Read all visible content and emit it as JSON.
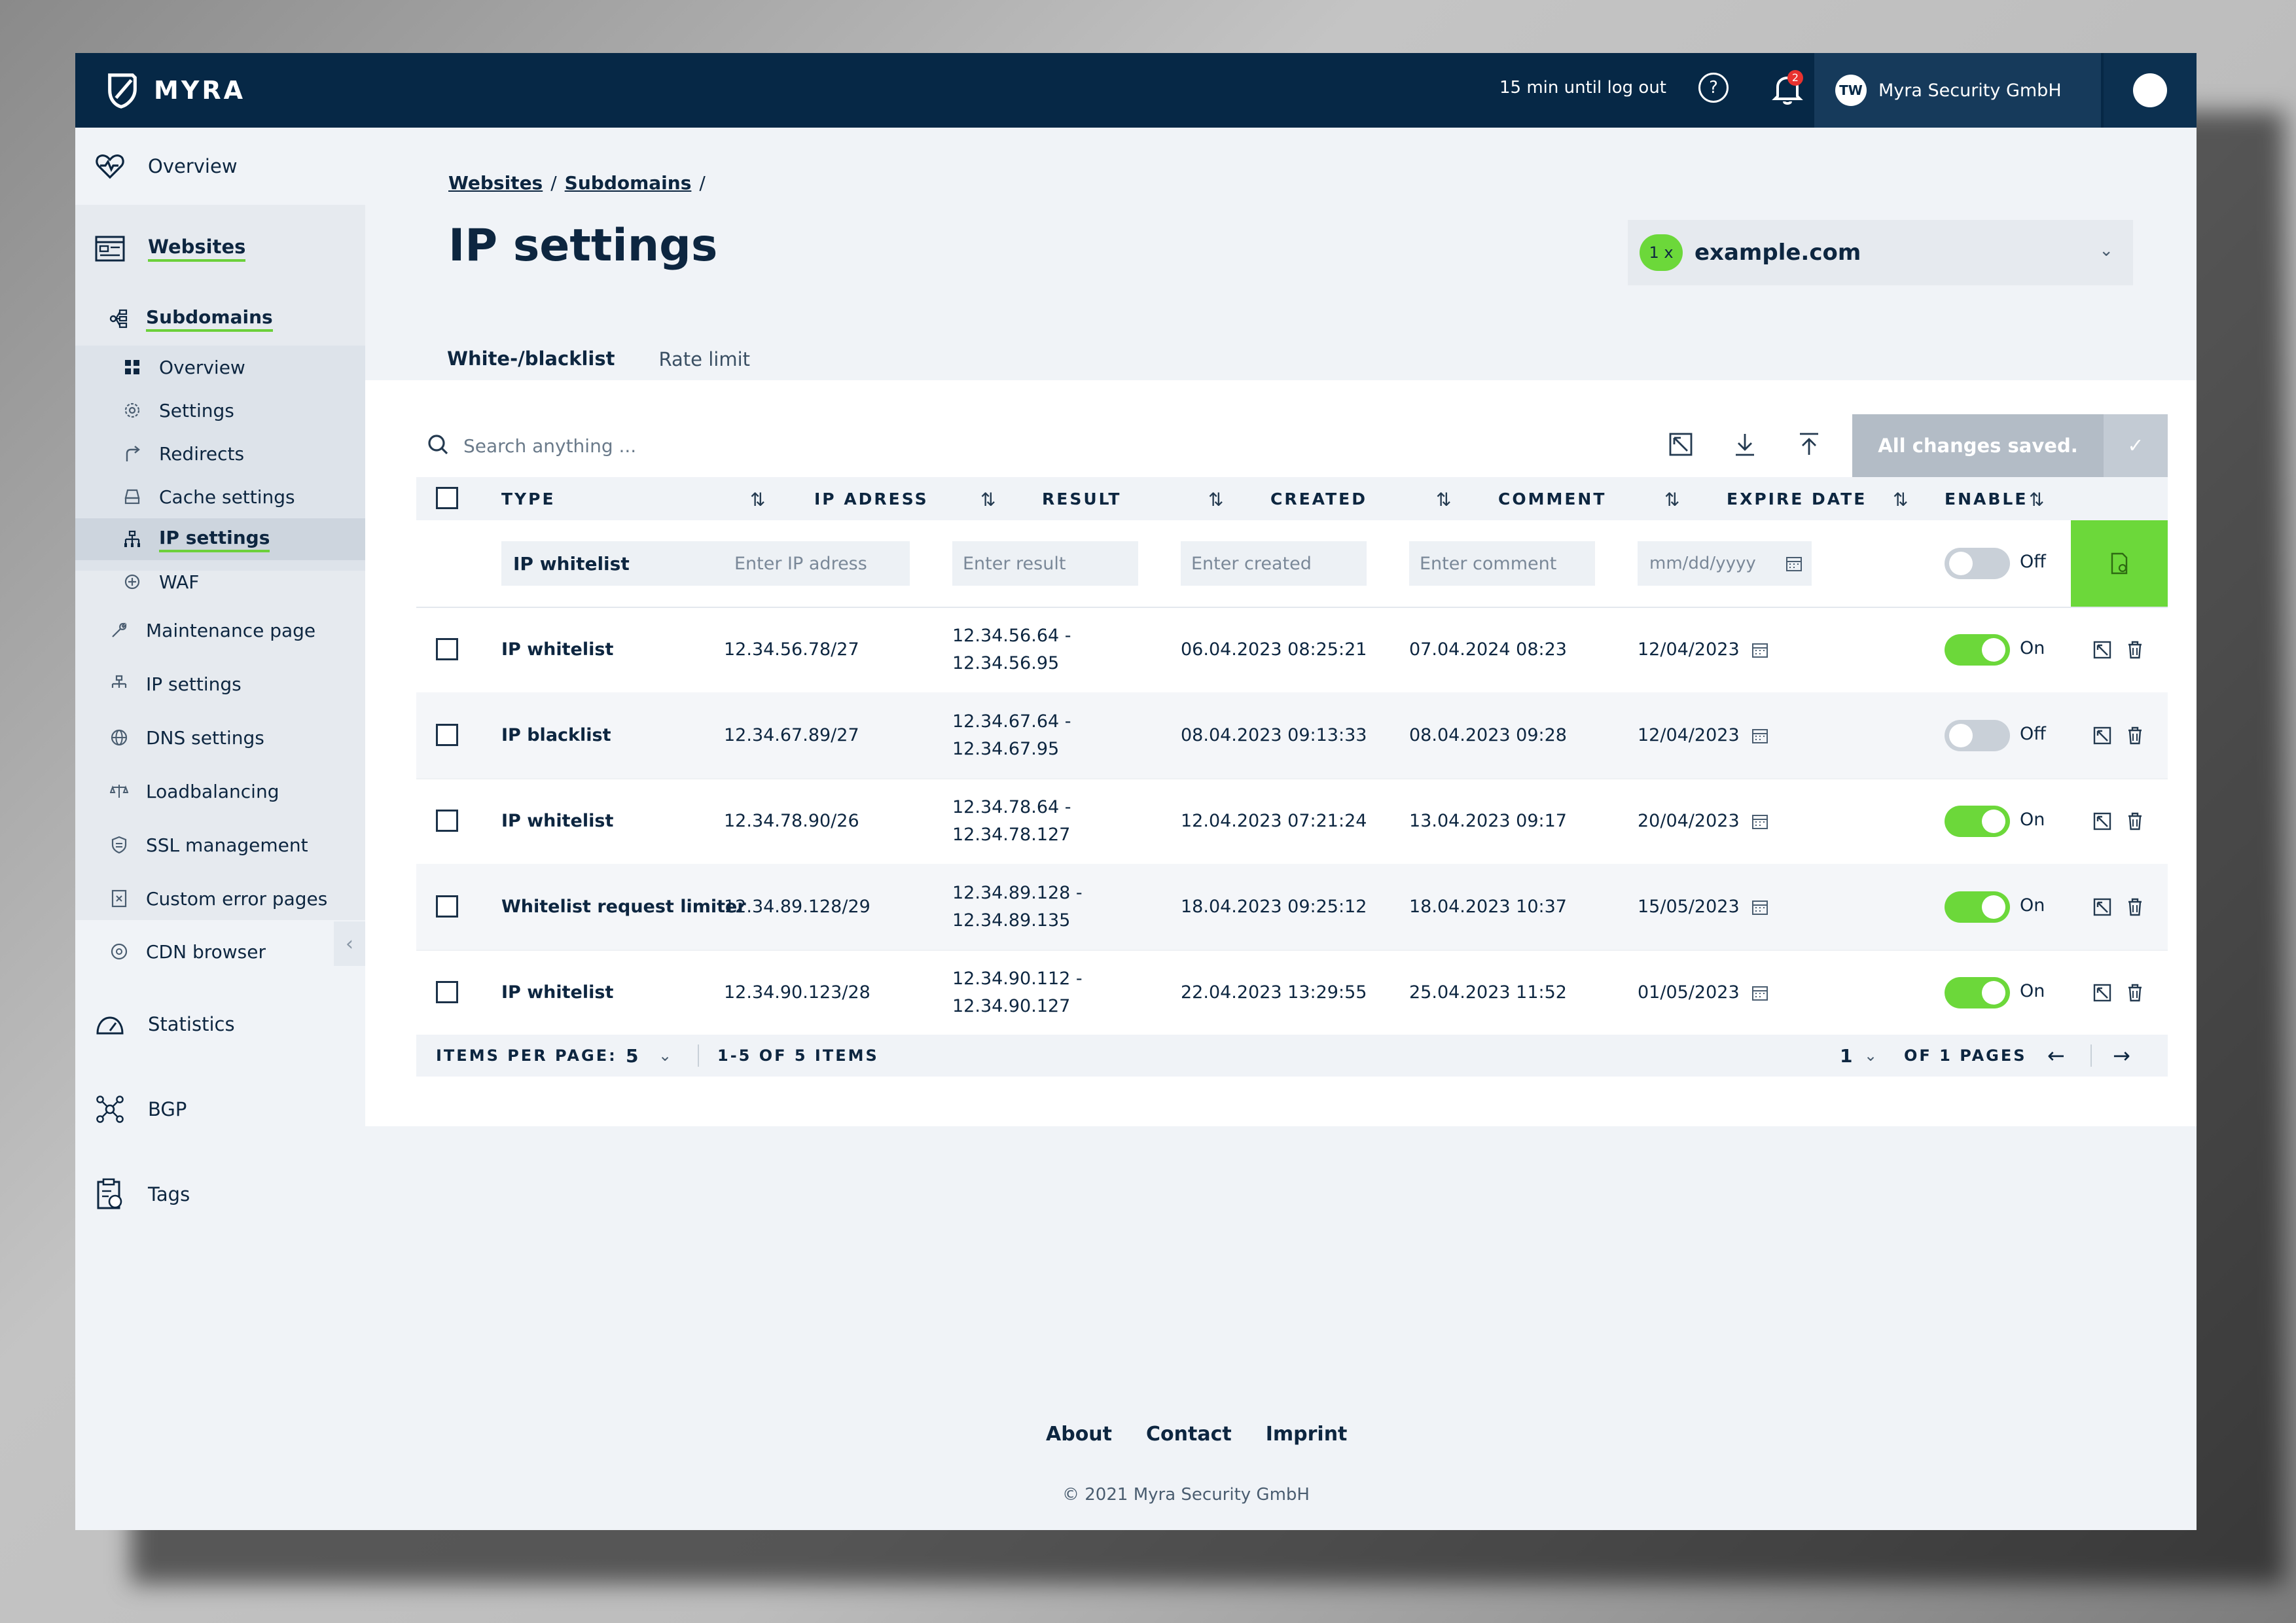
{
  "header": {
    "brand": "MYRA",
    "logout_timer": "15 min until log out",
    "help": "?",
    "notification_count": "2",
    "org_initials": "TW",
    "org_name": "Myra Security GmbH"
  },
  "sidebar": {
    "items": [
      {
        "label": "Overview",
        "icon": "heart-monitor-icon"
      },
      {
        "label": "Websites",
        "icon": "browser-window-icon"
      },
      {
        "label": "Subdomains",
        "icon": "subdomain-tree-icon"
      },
      {
        "label": "Overview",
        "icon": "grid-icon"
      },
      {
        "label": "Settings",
        "icon": "gear-icon"
      },
      {
        "label": "Redirects",
        "icon": "redirect-arrow-icon"
      },
      {
        "label": "Cache settings",
        "icon": "cache-drive-icon"
      },
      {
        "label": "IP settings",
        "icon": "network-icon"
      },
      {
        "label": "WAF",
        "icon": "firewall-icon"
      },
      {
        "label": "Maintenance page",
        "icon": "wrench-icon"
      },
      {
        "label": "IP settings",
        "icon": "network-icon"
      },
      {
        "label": "DNS settings",
        "icon": "globe-icon"
      },
      {
        "label": "Loadbalancing",
        "icon": "balance-icon"
      },
      {
        "label": "SSL management",
        "icon": "certificate-icon"
      },
      {
        "label": "Custom error pages",
        "icon": "error-page-icon"
      },
      {
        "label": "CDN browser",
        "icon": "cdn-icon"
      },
      {
        "label": "Statistics",
        "icon": "speedometer-icon"
      },
      {
        "label": "BGP",
        "icon": "bgp-network-icon"
      },
      {
        "label": "Tags",
        "icon": "tag-clipboard-icon"
      }
    ]
  },
  "breadcrumb": {
    "websites": "Websites",
    "subdomains": "Subdomains",
    "sep": "/"
  },
  "page": {
    "title": "IP settings",
    "domain_count": "1 x",
    "domain": "example.com"
  },
  "tabs": [
    {
      "label": "White-/blacklist"
    },
    {
      "label": "Rate limit"
    }
  ],
  "toolbar": {
    "search_placeholder": "Search anything ...",
    "status": "All changes saved."
  },
  "table": {
    "headers": [
      "TYPE",
      "IP ADRESS",
      "RESULT",
      "CREATED",
      "COMMENT",
      "EXPIRE DATE",
      "ENABLE"
    ],
    "filter": {
      "type_value": "IP whitelist",
      "ip_placeholder": "Enter IP adress",
      "result_placeholder": "Enter result",
      "created_placeholder": "Enter created",
      "comment_placeholder": "Enter comment",
      "date_placeholder": "mm/dd/yyyy",
      "enable_label": "Off"
    },
    "rows": [
      {
        "type": "IP whitelist",
        "ip": "12.34.56.78/27",
        "result1": "12.34.56.64 -",
        "result2": "12.34.56.95",
        "created": "06.04.2023 08:25:21",
        "comment": "07.04.2024 08:23",
        "expire": "12/04/2023",
        "enabled": "On"
      },
      {
        "type": "IP blacklist",
        "ip": "12.34.67.89/27",
        "result1": "12.34.67.64 -",
        "result2": "12.34.67.95",
        "created": "08.04.2023 09:13:33",
        "comment": "08.04.2023 09:28",
        "expire": "12/04/2023",
        "enabled": "Off"
      },
      {
        "type": "IP whitelist",
        "ip": "12.34.78.90/26",
        "result1": "12.34.78.64 -",
        "result2": "12.34.78.127",
        "created": "12.04.2023 07:21:24",
        "comment": "13.04.2023 09:17",
        "expire": "20/04/2023",
        "enabled": "On"
      },
      {
        "type": "Whitelist request limiter",
        "ip": "12.34.89.128/29",
        "result1": "12.34.89.128 -",
        "result2": "12.34.89.135",
        "created": "18.04.2023 09:25:12",
        "comment": "18.04.2023 10:37",
        "expire": "15/05/2023",
        "enabled": "On"
      },
      {
        "type": "IP whitelist",
        "ip": "12.34.90.123/28",
        "result1": "12.34.90.112 -",
        "result2": "12.34.90.127",
        "created": "22.04.2023 13:29:55",
        "comment": "25.04.2023 11:52",
        "expire": "01/05/2023",
        "enabled": "On"
      }
    ]
  },
  "pagination": {
    "items_per_page_label": "ITEMS PER PAGE:",
    "items_per_page": "5",
    "range": "1-5 OF 5 ITEMS",
    "page": "1",
    "of_pages": "OF 1 PAGES",
    "prev": "←",
    "next": "→"
  },
  "footer": {
    "about": "About",
    "contact": "Contact",
    "imprint": "Imprint",
    "copyright": "© 2021 Myra Security GmbH"
  },
  "colors": {
    "navy": "#062846",
    "accent_green": "#6cd83a",
    "text": "#0d2640",
    "disabled_gray": "#b3bcc6"
  }
}
